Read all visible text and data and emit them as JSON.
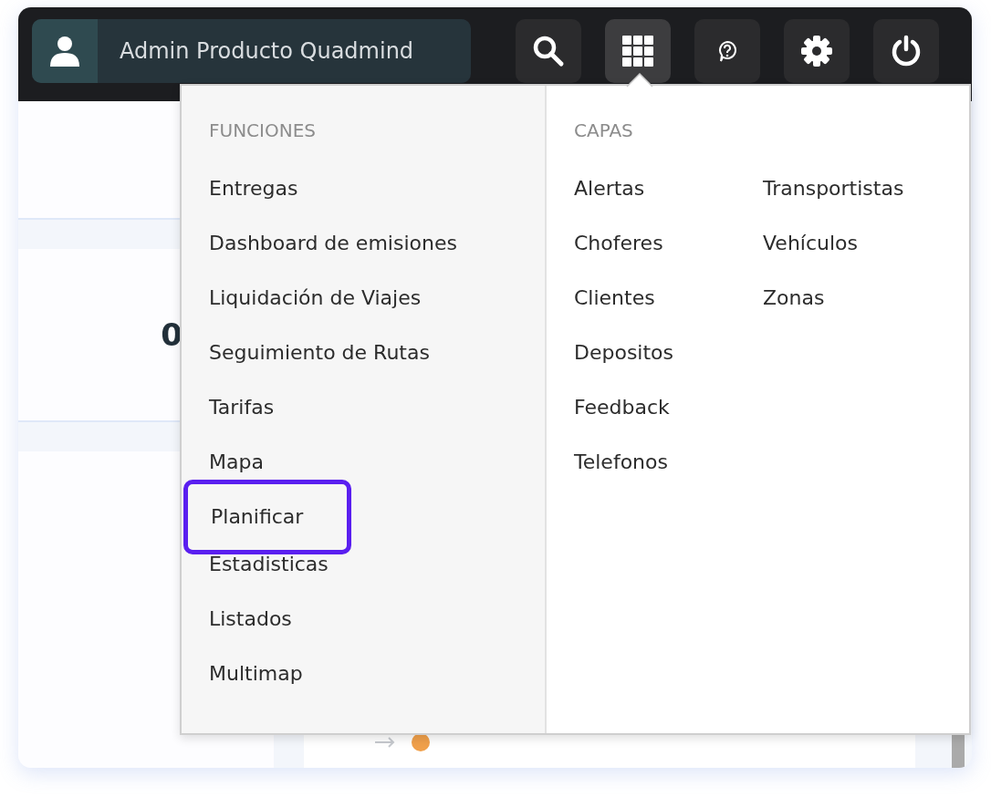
{
  "user": {
    "name": "Admin Producto Quadmind"
  },
  "toolbar": [
    {
      "kind": "search",
      "selected": false
    },
    {
      "kind": "apps",
      "selected": true
    },
    {
      "kind": "help",
      "selected": false
    },
    {
      "kind": "settings",
      "selected": false
    },
    {
      "kind": "power",
      "selected": false
    }
  ],
  "background": {
    "summary_value": "0",
    "status_row": {
      "color": "#f0a04b"
    }
  },
  "menu": {
    "funciones": {
      "heading": "FUNCIONES",
      "items": [
        {
          "label": "Entregas",
          "highlighted": false
        },
        {
          "label": "Dashboard de emisiones",
          "highlighted": false
        },
        {
          "label": "Liquidación de Viajes",
          "highlighted": false
        },
        {
          "label": "Seguimiento de Rutas",
          "highlighted": false
        },
        {
          "label": "Tarifas",
          "highlighted": false
        },
        {
          "label": "Mapa",
          "highlighted": false
        },
        {
          "label": "Planificar",
          "highlighted": true
        },
        {
          "label": "Estadisticas",
          "highlighted": false
        },
        {
          "label": "Listados",
          "highlighted": false
        },
        {
          "label": "Multimap",
          "highlighted": false
        }
      ]
    },
    "capas": {
      "heading": "CAPAS",
      "columns": [
        [
          "Alertas",
          "Choferes",
          "Clientes",
          "Depositos",
          "Feedback",
          "Telefonos"
        ],
        [
          "Transportistas",
          "Vehículos",
          "Zonas"
        ]
      ]
    }
  }
}
